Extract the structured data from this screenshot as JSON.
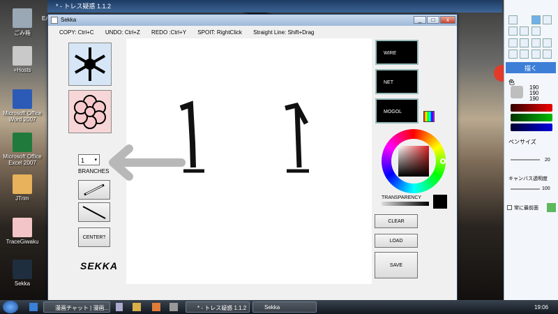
{
  "desktop": {
    "icons": [
      "ごみ箱",
      "+Hosts",
      "Microsoft Office\nWord 2007",
      "Microsoft Office\nExcel 2007",
      "JTrim",
      "TraceGiwaku",
      "Sekka"
    ],
    "partial_label": "EA"
  },
  "back_window": {
    "title": "* - トレス疑惑 1.1.2"
  },
  "sekka": {
    "title": "Sekka",
    "shortcuts": [
      "COPY: Ctrl+C",
      "UNDO: Ctrl+Z",
      "REDO :Ctrl+Y",
      "SPOIT: RightClick",
      "Straight Line: Shift+Drag"
    ],
    "branches_value": "1",
    "branches_label": "BRANCHES",
    "center_button": "CENTER?",
    "logo": "SEKKA",
    "presets": [
      "WIRE",
      "NET",
      "MOGOL"
    ],
    "transparency_label": "TRANSPARENCY",
    "clear_button": "CLEAR",
    "load_button": "LOAD",
    "save_button": "SAVE"
  },
  "side_panel": {
    "draw_button": "描く",
    "color_label": "色",
    "rgb": [
      "190",
      "190",
      "190"
    ],
    "pen_size_label": "ペンサイズ",
    "pen_size": "20",
    "canvas_transparency_label": "キャンバス透明度",
    "canvas_transparency": "100",
    "always_on_top_label": "常に最前面"
  },
  "taskbar": {
    "tasks": [
      "漫画チャット | 漫画...",
      "* - トレス疑惑 1.1.2",
      "Sekka"
    ],
    "clock": "19:06"
  }
}
